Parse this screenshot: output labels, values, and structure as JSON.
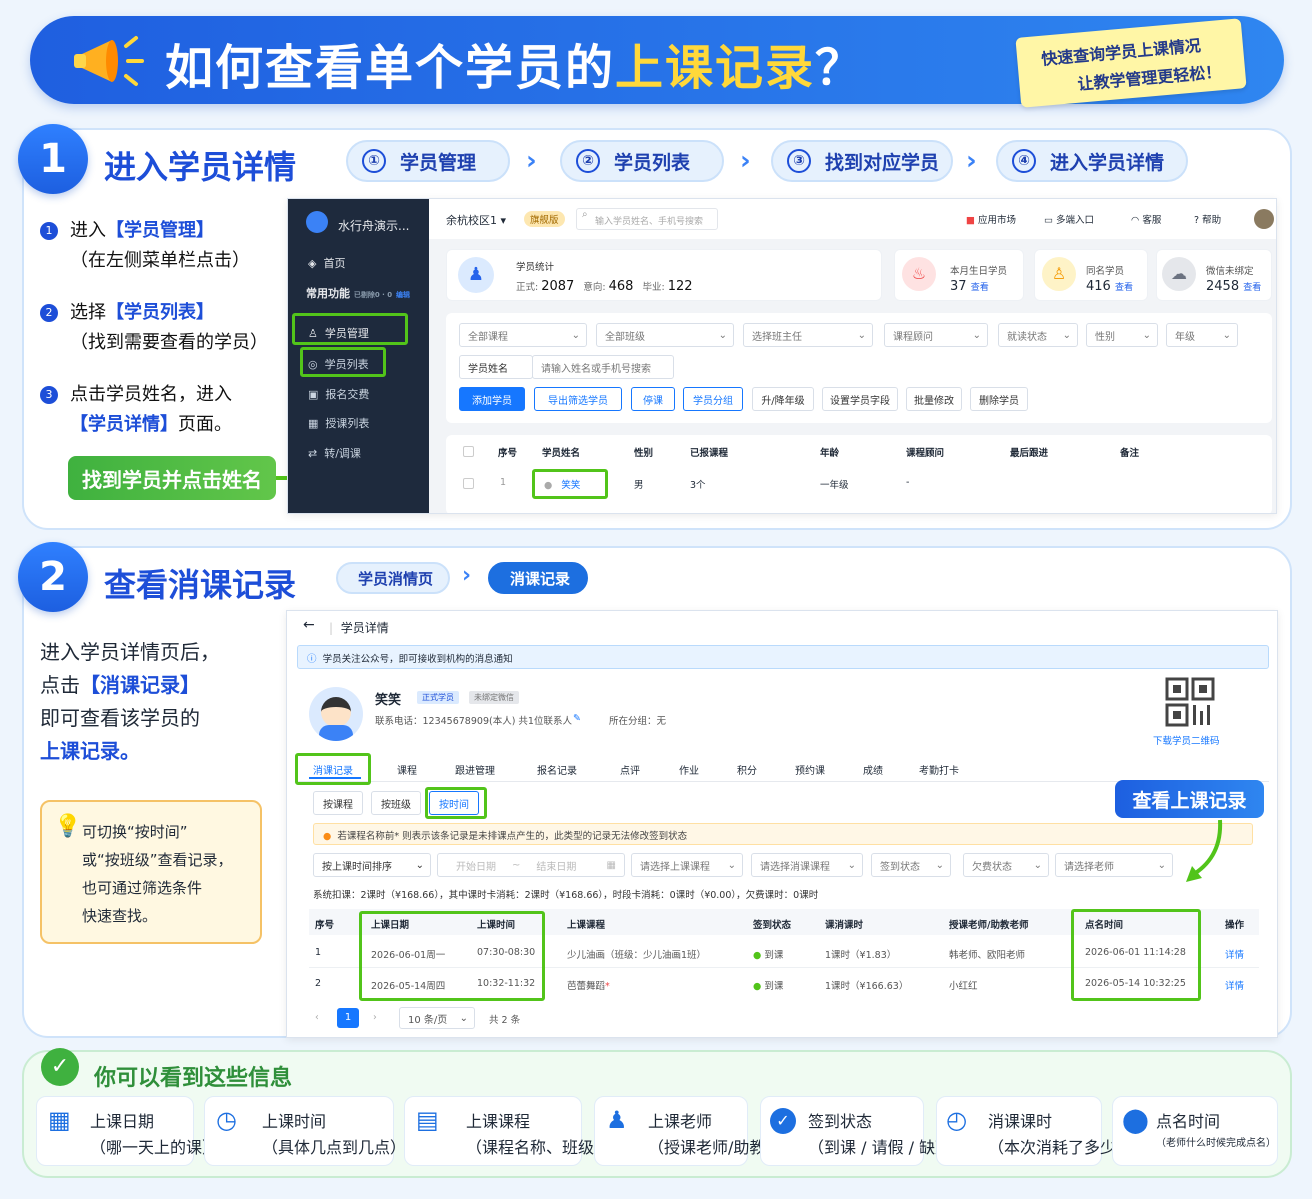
{
  "banner": {
    "title_a": "如何查看单个学员的",
    "title_b": "上课记录",
    "title_c": "？",
    "note_1": "快速查询学员上课情况",
    "note_2": "让教学管理更轻松！"
  },
  "s1": {
    "num": "1",
    "title": "进入学员详情",
    "chips": [
      {
        "n": "①",
        "l": "学员管理"
      },
      {
        "n": "②",
        "l": "学员列表"
      },
      {
        "n": "③",
        "l": "找到对应学员"
      },
      {
        "n": "④",
        "l": "进入学员详情"
      }
    ],
    "step1_a": "进入",
    "step1_b": "【学员管理】",
    "step1_c": "（在左侧菜单栏点击）",
    "step2_a": "选择",
    "step2_b": "【学员列表】",
    "step2_c": "（找到需要查看的学员）",
    "step3_a": "点击学员姓名，进入",
    "step3_b": "【学员详情】",
    "step3_c": "页面。",
    "tag": "找到学员并点击姓名"
  },
  "app": {
    "org": "水行舟演示...",
    "home": "首页",
    "common": "常用功能",
    "common_hint": "已剔除0 · 0",
    "common_link": "编辑",
    "menu": [
      "学员管理",
      "学员列表",
      "报名交费",
      "授课列表",
      "转/调课"
    ],
    "campus": "余杭校区1",
    "badge": "旗舰版",
    "search_ph": "输入学员姓名、手机号搜索",
    "top": [
      "应用市场",
      "多端入口",
      "客服",
      "帮助"
    ],
    "stat_title": "学员统计",
    "formal_l": "正式:",
    "formal": "2087",
    "intent_l": "意向:",
    "intent": "468",
    "grad_l": "毕业:",
    "grad": "122",
    "bday_l": "本月生日学员",
    "bday": "37",
    "same_l": "同名学员",
    "same": "416",
    "wx_l": "微信未绑定",
    "wx": "2458",
    "view": "查看",
    "filters": [
      "全部课程",
      "全部班级",
      "选择班主任",
      "课程顾问",
      "就读状态",
      "性别",
      "年级"
    ],
    "name_l": "学员姓名",
    "name_ph": "请输入姓名或手机号搜索",
    "btns": [
      "添加学员",
      "导出筛选学员",
      "停课",
      "学员分组",
      "升/降年级",
      "设置学员字段",
      "批量修改",
      "删除学员"
    ],
    "cols": [
      "序号",
      "学员姓名",
      "性别",
      "已报课程",
      "年龄",
      "课程顾问",
      "最后跟进",
      "备注"
    ],
    "row": {
      "no": "1",
      "name": "笑笑",
      "sex": "男",
      "courses": "3个",
      "age": "一年级",
      "adv": "-"
    }
  },
  "s2": {
    "num": "2",
    "title": "查看消课记录",
    "chip_a": "学员消情页",
    "chip_b": "消课记录",
    "desc": [
      "进入学员详情页后，",
      "点击",
      "【消课记录】",
      "即可查看该学员的",
      "上课记录。"
    ],
    "tip": [
      "可切换“按时间”",
      "或“按班级”查看记录，",
      "也可通过筛选条件",
      "快速查找。"
    ],
    "callout": "查看上课记录"
  },
  "detail": {
    "back": "学员详情",
    "notice": "学员关注公众号，即可接收到机构的消息通知",
    "name": "笑笑",
    "tag1": "正式学员",
    "tag2": "未绑定微信",
    "phone": "联系电话：12345678909(本人)  共1位联系人",
    "group": "所在分组：无",
    "qr": "下载学员二维码",
    "tabs": [
      "消课记录",
      "课程",
      "跟进管理",
      "报名记录",
      "点评",
      "作业",
      "积分",
      "预约课",
      "成绩",
      "考勤打卡"
    ],
    "sub": [
      "按课程",
      "按班级",
      "按时间"
    ],
    "warn": "若课程名称前* 则表示该条记录是未排课点产生的，此类型的记录无法修改签到状态",
    "f": [
      "按上课时间排序",
      "开始日期",
      "~",
      "结束日期",
      "请选择上课课程",
      "请选择消课课程",
      "签到状态",
      "欠费状态",
      "请选择老师"
    ],
    "summary": "系统扣课：2课时（¥168.66），其中课时卡消耗：2课时（¥168.66），时段卡消耗：0课时（¥0.00），欠费课时：0课时",
    "cols": [
      "序号",
      "上课日期",
      "上课时间",
      "上课课程",
      "签到状态",
      "课消课时",
      "授课老师/助教老师",
      "点名时间",
      "操作"
    ],
    "rows": [
      {
        "no": "1",
        "date": "2026-06-01周一",
        "time": "07:30-08:30",
        "course": "少儿油画（班级：少儿油画1班）",
        "sign": "到课",
        "hours": "1课时（¥1.83）",
        "teacher": "韩老师、欧阳老师",
        "roll": "2026-06-01 11:14:28",
        "op": "详情"
      },
      {
        "no": "2",
        "date": "2026-05-14周四",
        "time": "10:32-11:32",
        "course": "芭蕾舞蹈",
        "sign": "到课",
        "hours": "1课时（¥166.63）",
        "teacher": "小红红",
        "roll": "2026-05-14 10:32:25",
        "op": "详情"
      }
    ],
    "page": "1",
    "per": "10 条/页",
    "total": "共 2 条"
  },
  "s3": {
    "title": "你可以看到这些信息",
    "items": [
      {
        "t": "上课日期",
        "s": "（哪一天上的课）"
      },
      {
        "t": "上课时间",
        "s": "（具体几点到几点）"
      },
      {
        "t": "上课课程",
        "s": "（课程名称、班级）"
      },
      {
        "t": "上课老师",
        "s": "（授课老师/助教）"
      },
      {
        "t": "签到状态",
        "s": "（到课 / 请假 / 缺勤等）"
      },
      {
        "t": "消课课时",
        "s": "（本次消耗了多少课时）"
      },
      {
        "t": "点名时间",
        "s": "（老师什么时候完成点名）"
      }
    ]
  }
}
